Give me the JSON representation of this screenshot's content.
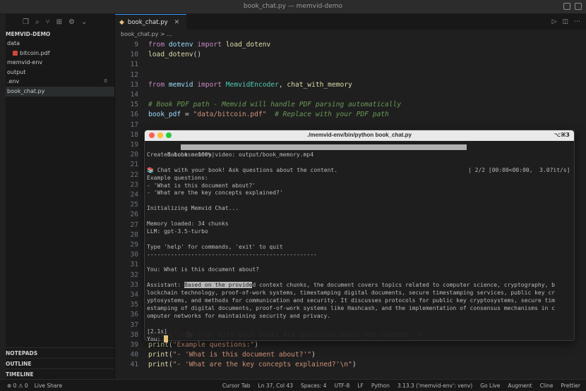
{
  "window": {
    "title": "book_chat.py — memvid-demo"
  },
  "sidebar": {
    "project": "MEMVID-DEMO",
    "tree": [
      {
        "label": "data",
        "indent": 0
      },
      {
        "label": "bitcoin.pdf",
        "indent": 1,
        "icon": "pdf-icon"
      },
      {
        "label": "memvid-env",
        "indent": 0
      },
      {
        "label": "output",
        "indent": 0
      },
      {
        "label": ".env",
        "indent": 0,
        "badge": "0"
      },
      {
        "label": "book_chat.py",
        "indent": 0,
        "active": true
      }
    ],
    "panels": [
      "OUTLINE",
      "TIMELINE"
    ],
    "notepads": "NOTEPADS"
  },
  "editor": {
    "tab_label": "book_chat.py",
    "breadcrumb": "book_chat.py > ...",
    "lines": [
      {
        "n": "9",
        "parts": [
          [
            "kw",
            "from "
          ],
          [
            "var",
            "dotenv "
          ],
          [
            "kw",
            "import "
          ],
          [
            "fn",
            "load_dotenv"
          ]
        ]
      },
      {
        "n": "10",
        "parts": [
          [
            "fn",
            "load_dotenv"
          ],
          [
            "",
            "()"
          ]
        ]
      },
      {
        "n": "11",
        "parts": []
      },
      {
        "n": "12",
        "parts": []
      },
      {
        "n": "13",
        "parts": [
          [
            "kw",
            "from "
          ],
          [
            "var",
            "memvid "
          ],
          [
            "kw",
            "import "
          ],
          [
            "cls",
            "MemvidEncoder"
          ],
          [
            "",
            ", "
          ],
          [
            "fn",
            "chat_with_memory"
          ]
        ]
      },
      {
        "n": "14",
        "parts": []
      },
      {
        "n": "15",
        "parts": [
          [
            "cm",
            "# Book PDF path - Memvid will handle PDF parsing automatically"
          ]
        ]
      },
      {
        "n": "16",
        "parts": [
          [
            "var",
            "book_pdf"
          ],
          [
            "",
            " = "
          ],
          [
            "str",
            "\"data/bitcoin.pdf\""
          ],
          [
            "",
            "  "
          ],
          [
            "cm",
            "# Replace with your PDF path"
          ]
        ]
      },
      {
        "n": "17",
        "parts": []
      },
      {
        "n": "18",
        "parts": []
      },
      {
        "n": "19",
        "parts": []
      },
      {
        "n": "20",
        "parts": []
      },
      {
        "n": "21",
        "parts": []
      },
      {
        "n": "22",
        "parts": []
      },
      {
        "n": "23",
        "parts": []
      },
      {
        "n": "24",
        "parts": []
      },
      {
        "n": "25",
        "parts": []
      },
      {
        "n": "26",
        "parts": []
      },
      {
        "n": "27",
        "parts": []
      },
      {
        "n": "28",
        "parts": []
      },
      {
        "n": "29",
        "parts": []
      },
      {
        "n": "30",
        "parts": []
      },
      {
        "n": "31",
        "parts": []
      },
      {
        "n": "32",
        "parts": []
      },
      {
        "n": "33",
        "parts": []
      },
      {
        "n": "34",
        "parts": []
      },
      {
        "n": "35",
        "parts": []
      },
      {
        "n": "36",
        "parts": []
      },
      {
        "n": "37",
        "parts": []
      },
      {
        "n": "38",
        "parts": [
          [
            "fn",
            "print"
          ],
          [
            "",
            "("
          ],
          [
            "str",
            "\"\\n📚 Chat with your book! Ask questions about the content.\""
          ],
          [
            "",
            ")"
          ]
        ]
      },
      {
        "n": "39",
        "parts": [
          [
            "fn",
            "print"
          ],
          [
            "",
            "("
          ],
          [
            "str",
            "\"Example questions:\""
          ],
          [
            "",
            ")"
          ]
        ]
      },
      {
        "n": "40",
        "parts": [
          [
            "fn",
            "print"
          ],
          [
            "",
            "("
          ],
          [
            "str",
            "\"- 'What is this document about?'\""
          ],
          [
            "",
            ")"
          ]
        ]
      },
      {
        "n": "41",
        "parts": [
          [
            "fn",
            "print"
          ],
          [
            "",
            "("
          ],
          [
            "str",
            "\"- 'What are the key concepts explained?'\\n\""
          ],
          [
            "",
            ")"
          ]
        ]
      }
    ]
  },
  "terminal": {
    "title": "./memvid-env/bin/python book_chat.py",
    "shortcut": "⌥⌘3",
    "progress_prefix": "Batches: 100%|",
    "progress_suffix": "| 2/2 [00:00<00:00,  3.07it/s]",
    "lines": [
      "Created book memory video: output/book_memory.mp4",
      "",
      "📚 Chat with your book! Ask questions about the content.",
      "Example questions:",
      "- 'What is this document about?'",
      "- 'What are the key concepts explained?'",
      "",
      "Initializing Memvid Chat...",
      "",
      "Memory loaded: 34 chunks",
      "LLM: gpt-3.5-turbo",
      "",
      "Type 'help' for commands, 'exit' to quit",
      "--------------------------------------------------",
      "",
      "You: What is this document about?",
      ""
    ],
    "answer_prefix": "Assistant: ",
    "answer_highlight": "Based on the provide",
    "answer_lines": [
      "d context chunks, the document covers topics related to computer science, cryptography, b",
      "lockchain technology, proof-of-work systems, timestamping digital documents, secure timestamping services, public key cr",
      "yptosystems, and methods for communication and security. It discusses protocols for public key cryptosystems, secure tim",
      "estamping of digital documents, proof-of-work systems like Hashcash, and the implementation of consensus mechanisms in c",
      "omputer networks for maintaining security and privacy."
    ],
    "timing": "[2.1s]",
    "prompt": "You: "
  },
  "statusbar": {
    "left": [
      "⊗ 0  ⚠ 0",
      "Live Share"
    ],
    "right": [
      "Cursor Tab",
      "Ln 37, Col 43",
      "Spaces: 4",
      "UTF-8",
      "LF",
      "Python",
      "3.13.3 ('memvid-env': venv)",
      "Go Live",
      "Augment",
      "Cline",
      "Prettier"
    ]
  }
}
